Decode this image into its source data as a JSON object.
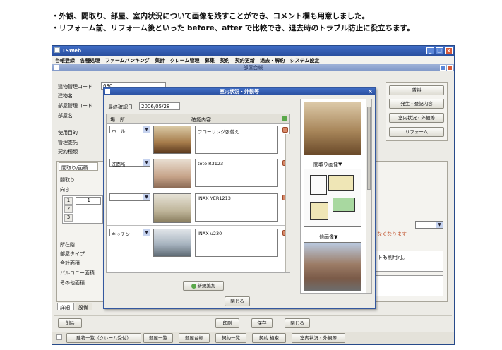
{
  "captions": {
    "line1": "・外観、間取り、部屋、室内状況について画像を残すことができ、コメント欄も用意しました。",
    "line2": "・リフォーム前、リフォーム後といった before、after で比較でき、退去時のトラブル防止に役立ちます。"
  },
  "app": {
    "title": "TSWeb",
    "subtitle": "部屋台帳"
  },
  "menu": [
    "台帳登録",
    "各種処理",
    "ファームバンキング",
    "集計",
    "クレーム管理",
    "募集",
    "契約",
    "契約更新",
    "退去・解約",
    "システム設定"
  ],
  "left_form": {
    "labels": [
      "建物管理コード",
      "建物名",
      "部屋管理コード",
      "部屋名",
      "使用目的",
      "管理委託",
      "契約種類"
    ],
    "building_code": "630",
    "tab_label": "間取り/面積",
    "madori_label": "間取り",
    "muki_label": "向き",
    "rows": [
      "1",
      "2",
      "3"
    ],
    "row1_value": "1",
    "lower_labels": [
      "所在階",
      "部屋タイプ",
      "合計面積",
      "バルコニー面積",
      "その他面積"
    ],
    "bottom_tabs": [
      "詳細",
      "設備"
    ]
  },
  "right_buttons": [
    "賃料",
    "発生・登記内容",
    "室内状況・外観等",
    "リフォーム"
  ],
  "right_notes": {
    "note1": "なくなります",
    "note2": "トも利用可。"
  },
  "dialog": {
    "title": "室内状況・外観等",
    "date_label": "最終確認日",
    "date_value": "2006/05/28",
    "col_place": "場　所",
    "col_content": "確認内容",
    "items": [
      {
        "place": "ホール",
        "content": "フローリング張替え"
      },
      {
        "place": "洗面所",
        "content": "toto R3123"
      },
      {
        "place": "",
        "content": "INAX YER1213"
      },
      {
        "place": "キッチン",
        "content": "INAX u230"
      }
    ],
    "add_button": "新規追加",
    "close_button": "閉じる",
    "side_labels": [
      "間取り画像▼",
      "他画像▼"
    ]
  },
  "footer_buttons": [
    "削除",
    "印刷",
    "保存",
    "閉じる"
  ],
  "bottom_nav": [
    "建物一覧（クレーム受付）",
    "部屋一覧",
    "部屋台帳",
    "契約一覧",
    "契約 検索",
    "室内状況・外観等"
  ],
  "colors": {
    "titlebar": "#2f58ad",
    "window_bg": "#ecebe6",
    "accent_orange": "#c0502a"
  }
}
